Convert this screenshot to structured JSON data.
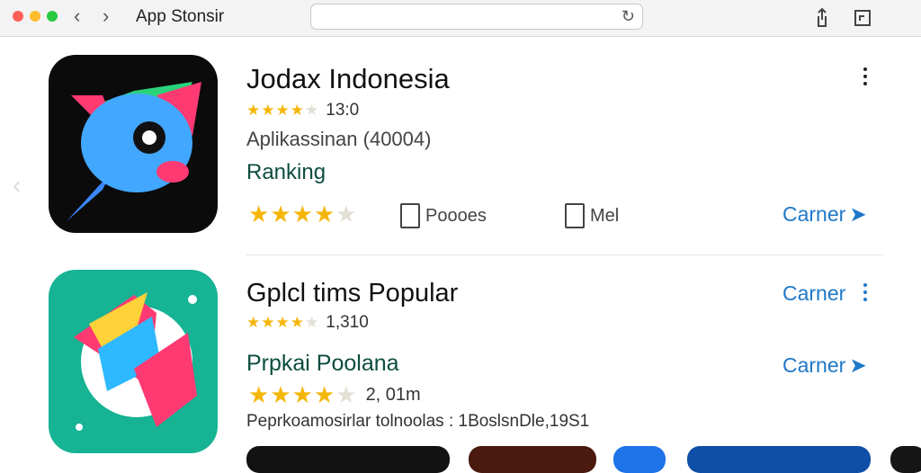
{
  "window": {
    "title": "App Stonsir",
    "back_icon": "chevron-left-icon",
    "forward_icon": "chevron-right-icon",
    "reload_icon": "reload-icon",
    "share_icon": "share-icon",
    "tabs_icon": "tabs-icon"
  },
  "apps": [
    {
      "name": "Jodax Indonesia",
      "rating_count": "13:0",
      "subtitle": "Aplikassinan (40004)",
      "section": "Ranking",
      "rating": 4.5,
      "meta": [
        {
          "icon": "document-icon",
          "label": "Poooes"
        },
        {
          "icon": "bookmark-icon",
          "label": "Mel"
        }
      ],
      "action": "Carner",
      "colors": {
        "icon_bg": "#0b0b0b"
      }
    },
    {
      "name": "Gplcl tims Popular",
      "rating_count": "1,310",
      "section": "Prpkai Poolana",
      "rating_count_2": "2, 01m",
      "description": "Peprkoamosirlar tolnoolas : 1BoslsnDle,19S1",
      "action_top": "Carner",
      "action_bottom": "Carner",
      "rating": 4.5,
      "colors": {
        "icon_bg": "#16b394"
      }
    }
  ],
  "colors": {
    "accent": "#1f78c8",
    "star": "#f5b60a",
    "section_title": "#0c4d3f"
  }
}
